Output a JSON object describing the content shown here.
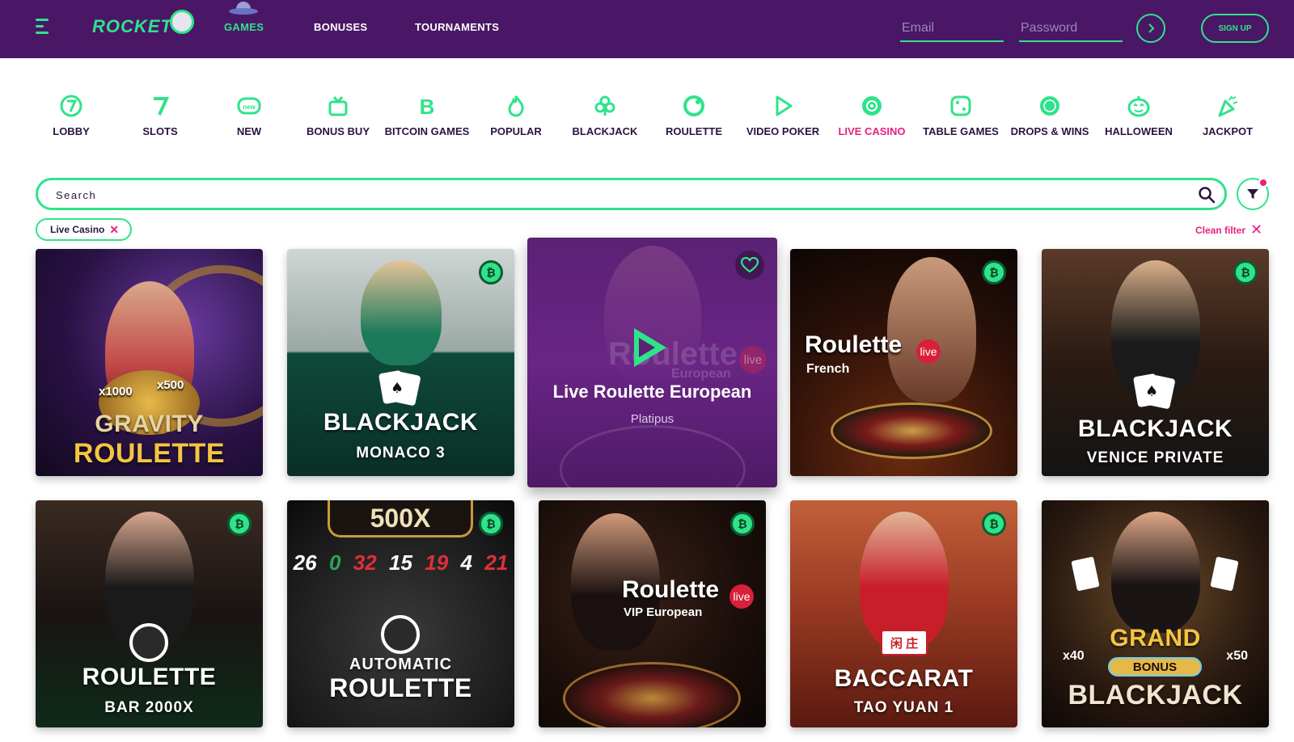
{
  "brand": {
    "name": "ROCKET"
  },
  "nav": {
    "items": [
      {
        "label": "GAMES",
        "active": true
      },
      {
        "label": "BONUSES",
        "active": false
      },
      {
        "label": "TOURNAMENTS",
        "active": false
      }
    ]
  },
  "login": {
    "email_placeholder": "Email",
    "password_placeholder": "Password",
    "signup_label": "SIGN UP"
  },
  "categories": [
    {
      "label": "LOBBY",
      "icon": "lobby-7-icon"
    },
    {
      "label": "SLOTS",
      "icon": "slots-7-icon"
    },
    {
      "label": "NEW",
      "icon": "new-badge-icon"
    },
    {
      "label": "BONUS BUY",
      "icon": "gift-icon"
    },
    {
      "label": "BITCOIN GAMES",
      "icon": "bitcoin-icon"
    },
    {
      "label": "POPULAR",
      "icon": "flame-icon"
    },
    {
      "label": "BLACKJACK",
      "icon": "club-icon"
    },
    {
      "label": "ROULETTE",
      "icon": "roulette-icon"
    },
    {
      "label": "VIDEO POKER",
      "icon": "play-icon"
    },
    {
      "label": "LIVE CASINO",
      "icon": "live-icon",
      "active": true
    },
    {
      "label": "TABLE GAMES",
      "icon": "dice-icon"
    },
    {
      "label": "DROPS & WINS",
      "icon": "drops-wins-icon"
    },
    {
      "label": "HALLOWEEN",
      "icon": "pumpkin-icon"
    },
    {
      "label": "JACKPOT",
      "icon": "party-popper-icon"
    }
  ],
  "search": {
    "placeholder": "Search"
  },
  "filters": {
    "active_chip": "Live Casino",
    "clean_label": "Clean filter"
  },
  "colors": {
    "header_bg": "#4a1766",
    "accent": "#2fe38a",
    "active_pink": "#e8207f",
    "text_dark": "#2b1440"
  },
  "games": {
    "row1": [
      {
        "line1": "GRAVITY",
        "line2": "ROULETTE",
        "badges": [
          "x1000",
          "x500"
        ]
      },
      {
        "line1": "BLACKJACK",
        "line2": "MONACO 3"
      },
      {
        "featured_title": "Live Roulette European",
        "provider": "Platipus",
        "ghost_text": "Roulette",
        "ghost_sub": "European",
        "ghost_tag": "live"
      },
      {
        "line1": "Roulette",
        "line2": "French",
        "tag": "live"
      },
      {
        "line1": "BLACKJACK",
        "line2": "VENICE PRIVATE"
      }
    ],
    "row2": [
      {
        "line1": "ROULETTE",
        "line2": "BAR 2000X"
      },
      {
        "top": "500X",
        "line1": "AUTOMATIC",
        "line2": "ROULETTE",
        "wheel_numbers": [
          "26",
          "0",
          "32",
          "15",
          "19",
          "4",
          "21"
        ]
      },
      {
        "line1": "Roulette",
        "line2": "VIP European",
        "tag": "live"
      },
      {
        "line1": "BACCARAT",
        "line2": "TAO YUAN 1",
        "chinese": "闲 庄"
      },
      {
        "line1": "GRAND",
        "line2": "BLACKJACK",
        "bonus": "BONUS",
        "left_mult": "x40",
        "right_mult": "x50"
      }
    ]
  }
}
